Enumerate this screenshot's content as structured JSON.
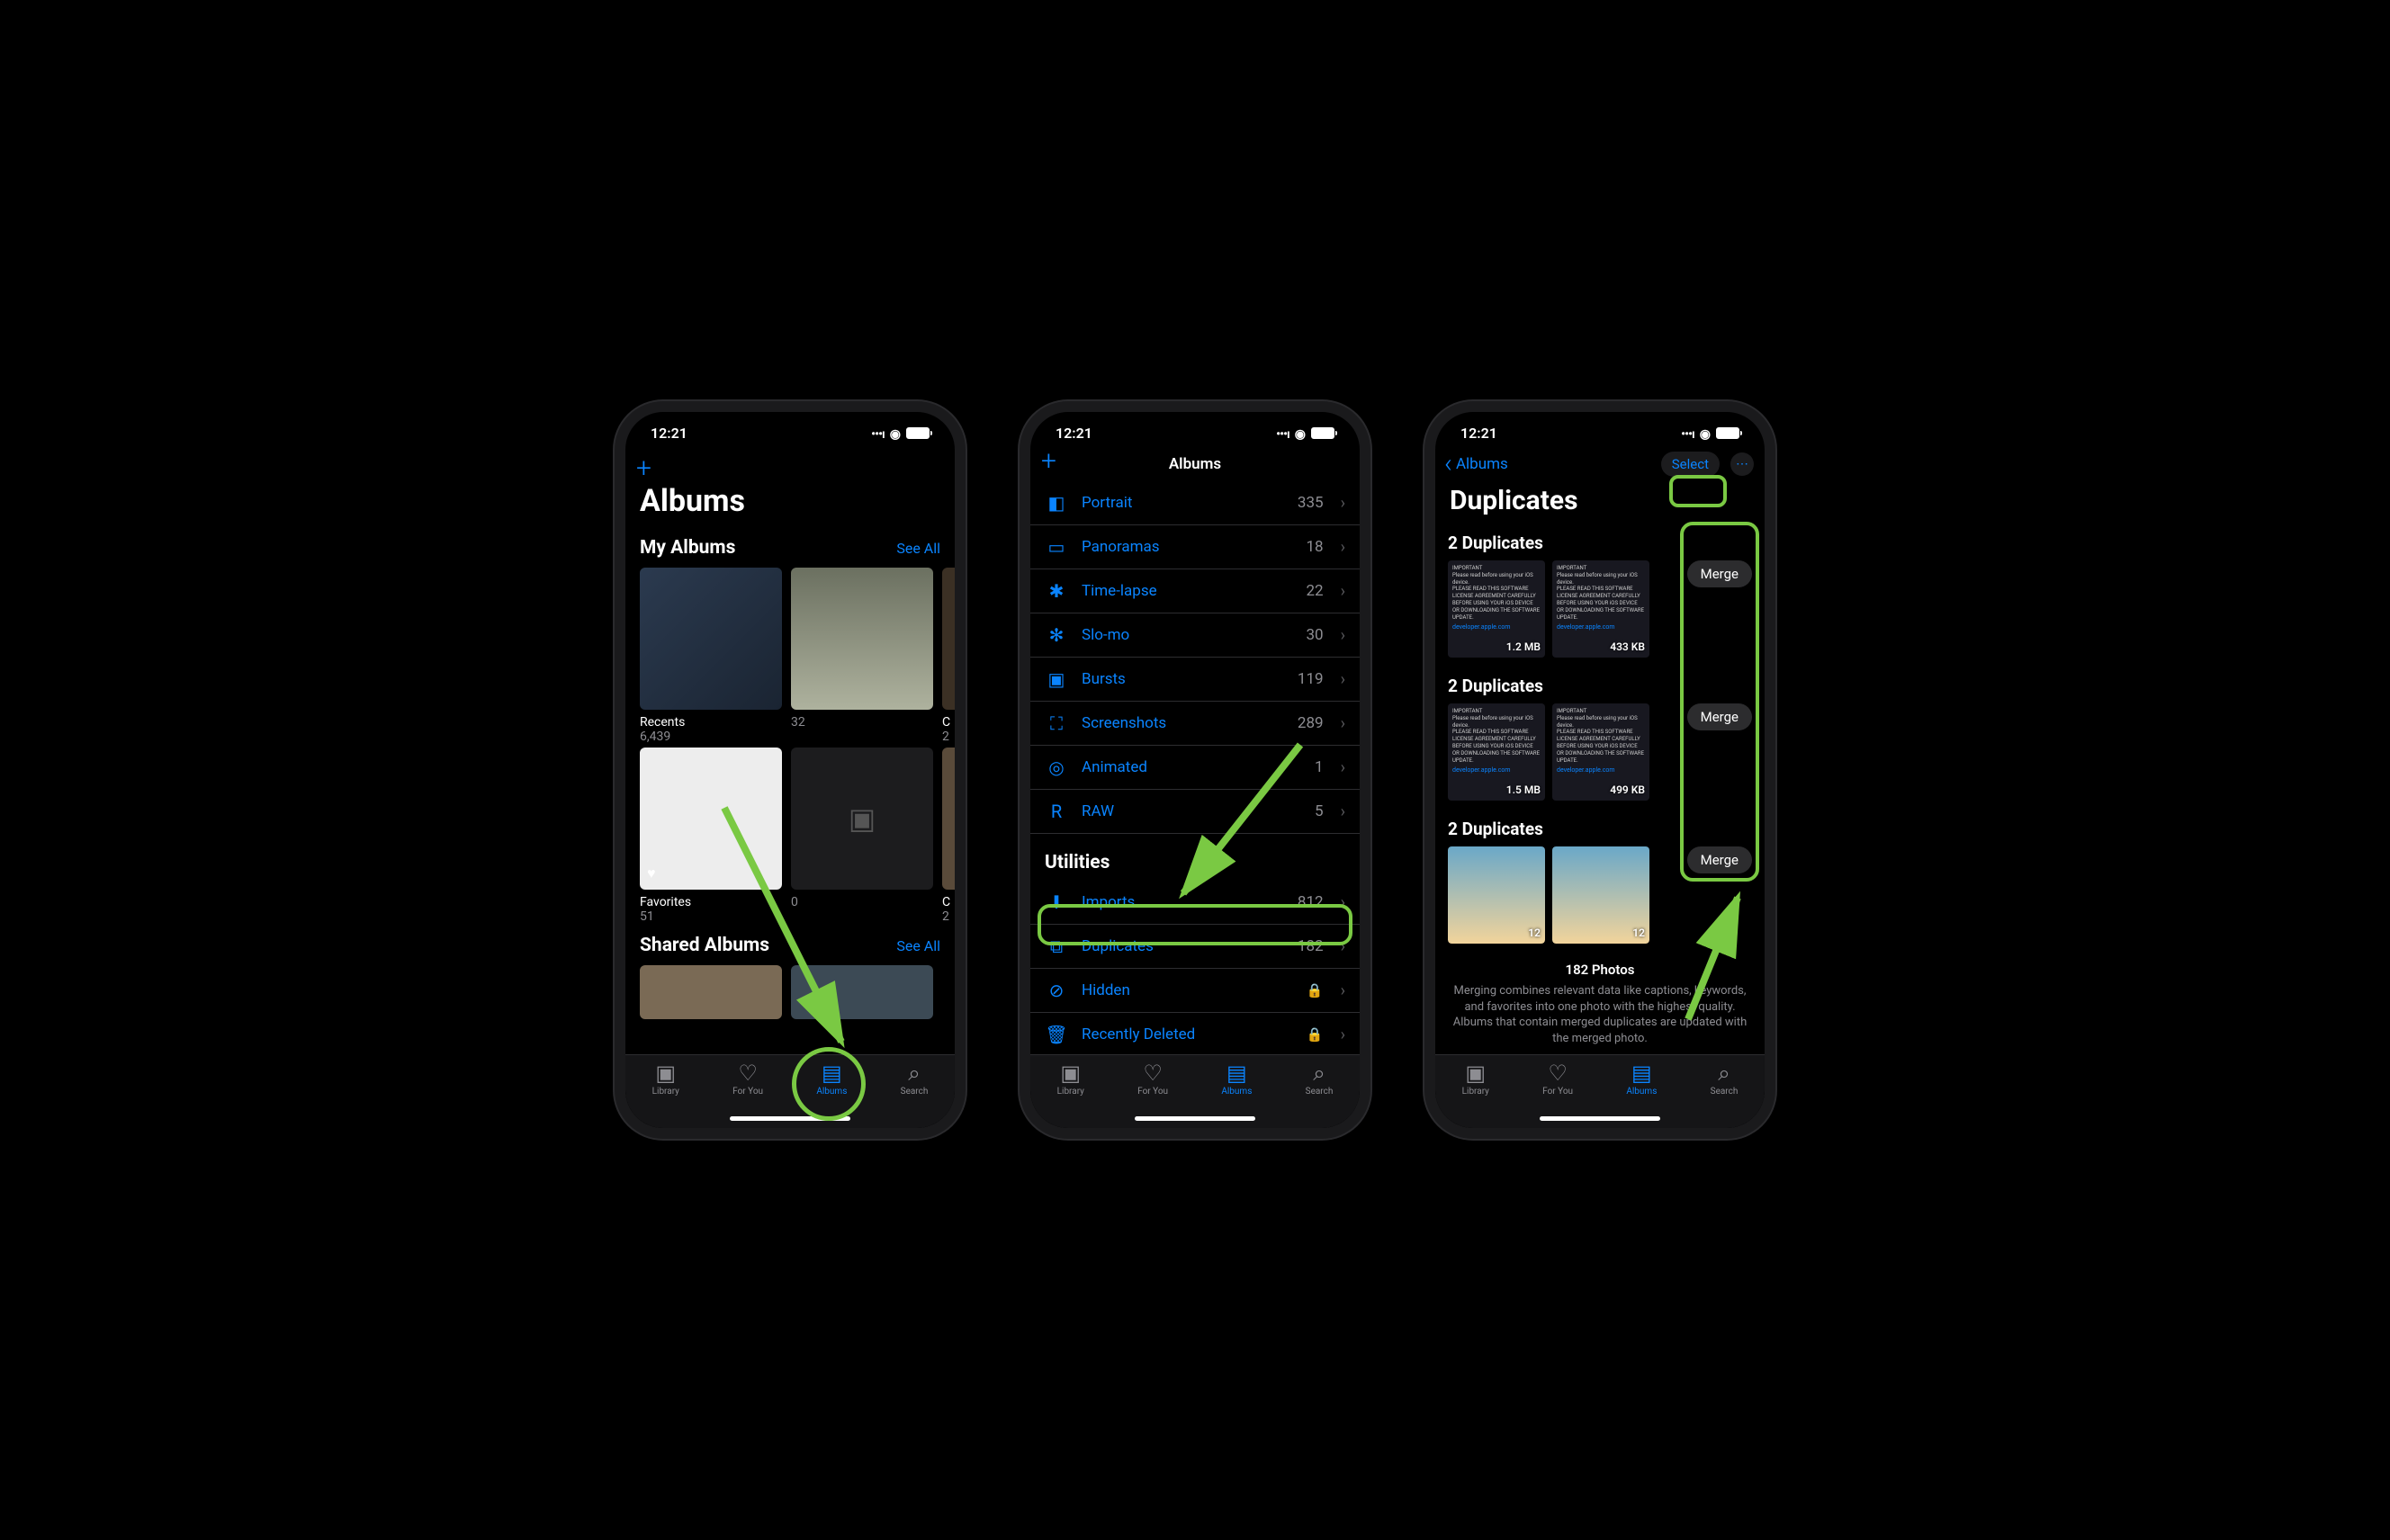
{
  "status": {
    "time": "12:21"
  },
  "tabs": {
    "library": "Library",
    "for_you": "For You",
    "albums": "Albums",
    "search": "Search"
  },
  "phone1": {
    "add": "+",
    "title": "Albums",
    "my_albums": {
      "label": "My Albums",
      "see_all": "See All"
    },
    "albums": [
      {
        "name": "Recents",
        "count": "6,439"
      },
      {
        "name": "",
        "count": "32"
      },
      {
        "name": "C",
        "count": "2"
      },
      {
        "name": "Favorites",
        "count": "51"
      },
      {
        "name": "",
        "count": "0"
      },
      {
        "name": "C",
        "count": "2"
      }
    ],
    "shared_albums": {
      "label": "Shared Albums",
      "see_all": "See All"
    }
  },
  "phone2": {
    "title": "Albums",
    "add": "+",
    "media_types": [
      {
        "icon": "◧",
        "label": "Portrait",
        "count": "335"
      },
      {
        "icon": "▭",
        "label": "Panoramas",
        "count": "18"
      },
      {
        "icon": "✱",
        "label": "Time-lapse",
        "count": "22"
      },
      {
        "icon": "✻",
        "label": "Slo-mo",
        "count": "30"
      },
      {
        "icon": "▣",
        "label": "Bursts",
        "count": "119"
      },
      {
        "icon": "⛶",
        "label": "Screenshots",
        "count": "289"
      },
      {
        "icon": "◎",
        "label": "Animated",
        "count": "1"
      },
      {
        "icon": "R",
        "label": "RAW",
        "count": "5"
      }
    ],
    "utilities_label": "Utilities",
    "utilities": [
      {
        "icon": "⬇",
        "label": "Imports",
        "count": "812",
        "lock": false
      },
      {
        "icon": "⧉",
        "label": "Duplicates",
        "count": "182",
        "lock": false
      },
      {
        "icon": "⊘",
        "label": "Hidden",
        "count": "",
        "lock": true
      },
      {
        "icon": "🗑",
        "label": "Recently Deleted",
        "count": "",
        "lock": true
      }
    ]
  },
  "phone3": {
    "back": "Albums",
    "select": "Select",
    "title": "Duplicates",
    "groups": [
      {
        "title": "2 Duplicates",
        "sizes": [
          "1.2 MB",
          "433 KB"
        ],
        "merge": "Merge"
      },
      {
        "title": "2 Duplicates",
        "sizes": [
          "1.5 MB",
          "499 KB"
        ],
        "merge": "Merge"
      },
      {
        "title": "2 Duplicates",
        "sizes": [
          "12",
          "12"
        ],
        "merge": "Merge"
      }
    ],
    "footer_count": "182 Photos",
    "footer_text": "Merging combines relevant data like captions, keywords, and favorites into one photo with the highest quality. Albums that contain merged duplicates are updated with the merged photo."
  }
}
